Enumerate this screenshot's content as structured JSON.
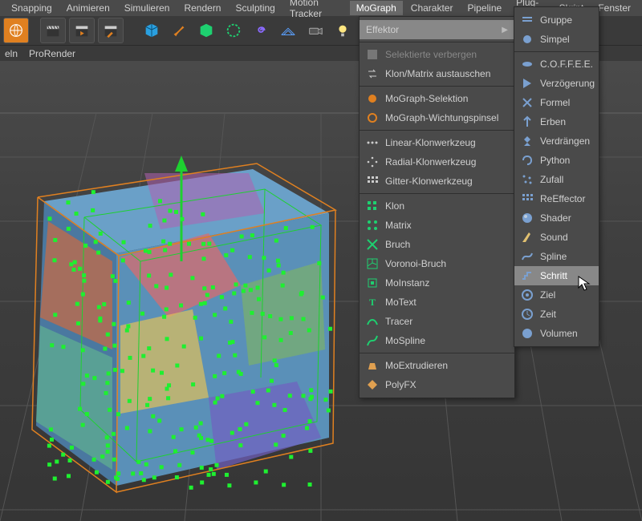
{
  "menubar": {
    "items": [
      "Snapping",
      "Animieren",
      "Simulieren",
      "Rendern",
      "Sculpting",
      "Motion Tracker",
      "MoGraph",
      "Charakter",
      "Pipeline",
      "Plug-ins",
      "Skript",
      "Fenster"
    ],
    "active_index": 6
  },
  "tabs": {
    "items": [
      "eln",
      "ProRender"
    ]
  },
  "colors": {
    "accent_orange": "#e08020",
    "accent_blue": "#2aa0e0",
    "accent_green": "#1ed030",
    "bg": "#3a3a3a",
    "menu": "#4a4a4a"
  },
  "toolbar_icons": [
    "globe-icon",
    "clapper-icon",
    "clapper-arrow-icon",
    "pencil-clapper-icon",
    "cube-icon",
    "brush-icon",
    "primitive-icon",
    "hexagon-icon",
    "spiral-icon",
    "grid-icon",
    "camera-icon",
    "light-icon"
  ],
  "mograph_menu": {
    "groups": [
      {
        "items": [
          {
            "label": "Effektor",
            "submenu": true,
            "highlight": true
          }
        ]
      },
      {
        "items": [
          {
            "label": "Selektierte verbergen",
            "dim": true
          },
          {
            "label": "Klon/Matrix austauschen"
          }
        ]
      },
      {
        "items": [
          {
            "label": "MoGraph-Selektion"
          },
          {
            "label": "MoGraph-Wichtungspinsel"
          }
        ]
      },
      {
        "items": [
          {
            "label": "Linear-Klonwerkzeug"
          },
          {
            "label": "Radial-Klonwerkzeug"
          },
          {
            "label": "Gitter-Klonwerkzeug"
          }
        ]
      },
      {
        "items": [
          {
            "label": "Klon"
          },
          {
            "label": "Matrix"
          },
          {
            "label": "Bruch"
          },
          {
            "label": "Voronoi-Bruch"
          },
          {
            "label": "MoInstanz"
          },
          {
            "label": "MoText"
          },
          {
            "label": "Tracer"
          },
          {
            "label": "MoSpline"
          }
        ]
      },
      {
        "items": [
          {
            "label": "MoExtrudieren"
          },
          {
            "label": "PolyFX"
          }
        ]
      }
    ]
  },
  "effektor_submenu": {
    "groups": [
      {
        "items": [
          {
            "label": "Gruppe"
          },
          {
            "label": "Simpel"
          }
        ]
      },
      {
        "items": [
          {
            "label": "C.O.F.F.E.E."
          },
          {
            "label": "Verzögerung"
          },
          {
            "label": "Formel"
          },
          {
            "label": "Erben"
          },
          {
            "label": "Verdrängen"
          },
          {
            "label": "Python"
          },
          {
            "label": "Zufall"
          },
          {
            "label": "ReEffector"
          },
          {
            "label": "Shader"
          },
          {
            "label": "Sound"
          },
          {
            "label": "Spline"
          },
          {
            "label": "Schritt",
            "hover": true
          },
          {
            "label": "Ziel"
          },
          {
            "label": "Zeit"
          },
          {
            "label": "Volumen"
          }
        ]
      }
    ]
  }
}
